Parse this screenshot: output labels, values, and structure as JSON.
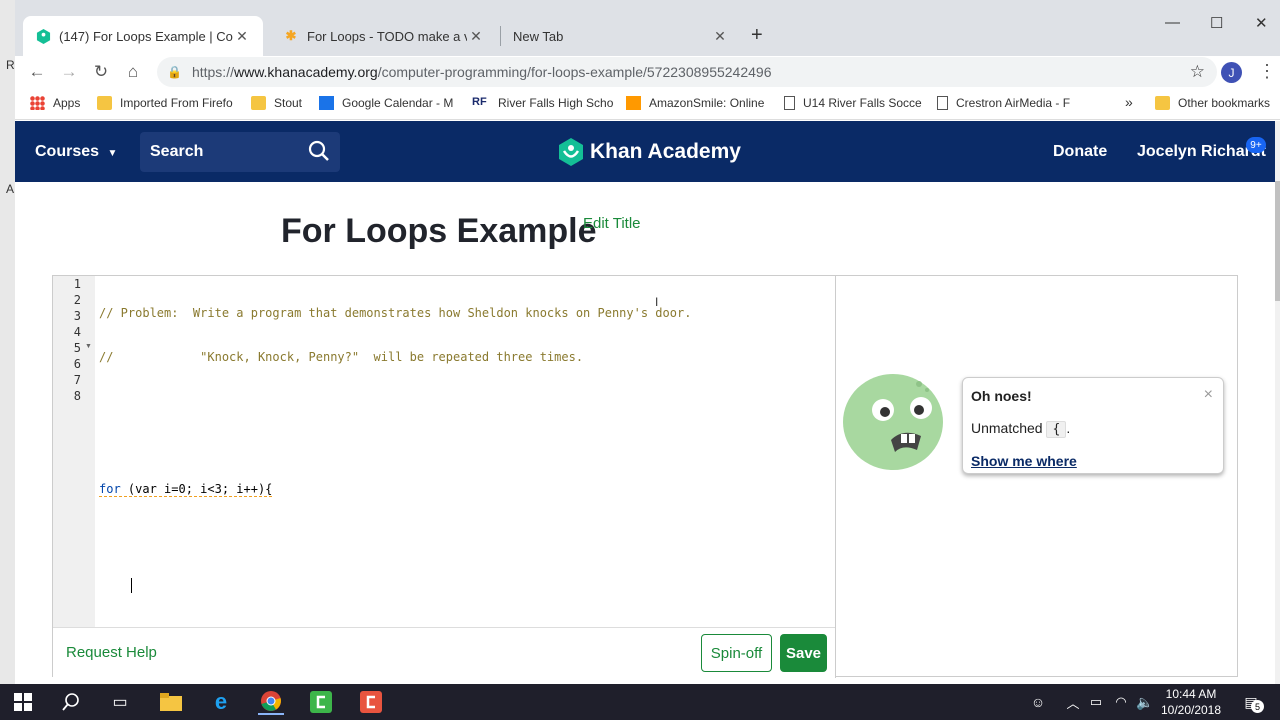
{
  "tabs": [
    {
      "title": "(147) For Loops Example | Compu",
      "active": true
    },
    {
      "title": "For Loops - TODO make a video",
      "active": false
    },
    {
      "title": "New Tab",
      "active": false
    }
  ],
  "url": {
    "prefix": "https://",
    "host": "www.khanacademy.org",
    "path": "/computer-programming/for-loops-example/5722308955242496"
  },
  "profile_initial": "J",
  "bookmarks": {
    "apps": "Apps",
    "b1": "Imported From Firefo",
    "b2": "Stout",
    "b3": "Google Calendar - M",
    "b4": "River Falls High Scho",
    "b5": "AmazonSmile: Online",
    "b6": "U14 River Falls Socce",
    "b7": "Crestron AirMedia - F",
    "more": "»",
    "other": "Other bookmarks"
  },
  "header": {
    "courses": "Courses",
    "search": "Search",
    "logo": "Khan Academy",
    "donate": "Donate",
    "user": "Jocelyn Richardt",
    "notif": "9+"
  },
  "page": {
    "title": "For Loops Example",
    "edit_title": "Edit Title"
  },
  "editor": {
    "line_numbers": [
      "1",
      "2",
      "3",
      "4",
      "5",
      "6",
      "7",
      "8"
    ],
    "line1": "// Problem:  Write a program that demonstrates how Sheldon knocks on Penny's door.",
    "line2": "//            \"Knock, Knock, Penny?\"  will be repeated three times.",
    "for_kw": "for",
    "for_rest": " (var i=0; i<3; i++){"
  },
  "footer": {
    "request_help": "Request Help",
    "spinoff": "Spin-off",
    "save": "Save"
  },
  "oh_noes": {
    "heading": "Oh noes!",
    "close": "×",
    "msg_pre": "Unmatched",
    "brace": "{",
    "msg_post": ".",
    "show": "Show me where"
  },
  "taskbar": {
    "time": "10:44 AM",
    "date": "10/20/2018",
    "notif_count": "5"
  },
  "desk_letters": [
    "R",
    "A"
  ]
}
